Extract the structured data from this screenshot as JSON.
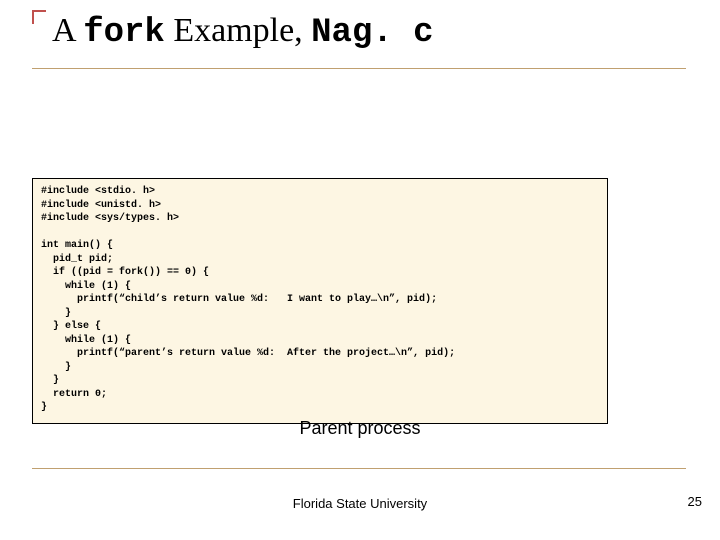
{
  "title": {
    "pre": "A ",
    "code1": "fork",
    "mid": " Example, ",
    "code2": "Nag. c"
  },
  "code": "#include <stdio. h>\n#include <unistd. h>\n#include <sys/types. h>\n\nint main() {\n  pid_t pid;\n  if ((pid = fork()) == 0) {\n    while (1) {\n      printf(“child’s return value %d:   I want to play…\\n”, pid);\n    }\n  } else {\n    while (1) {\n      printf(“parent’s return value %d:  After the project…\\n”, pid);\n    }\n  }\n  return 0;\n}",
  "caption": "Parent process",
  "footer": "Florida State University",
  "page": "25"
}
